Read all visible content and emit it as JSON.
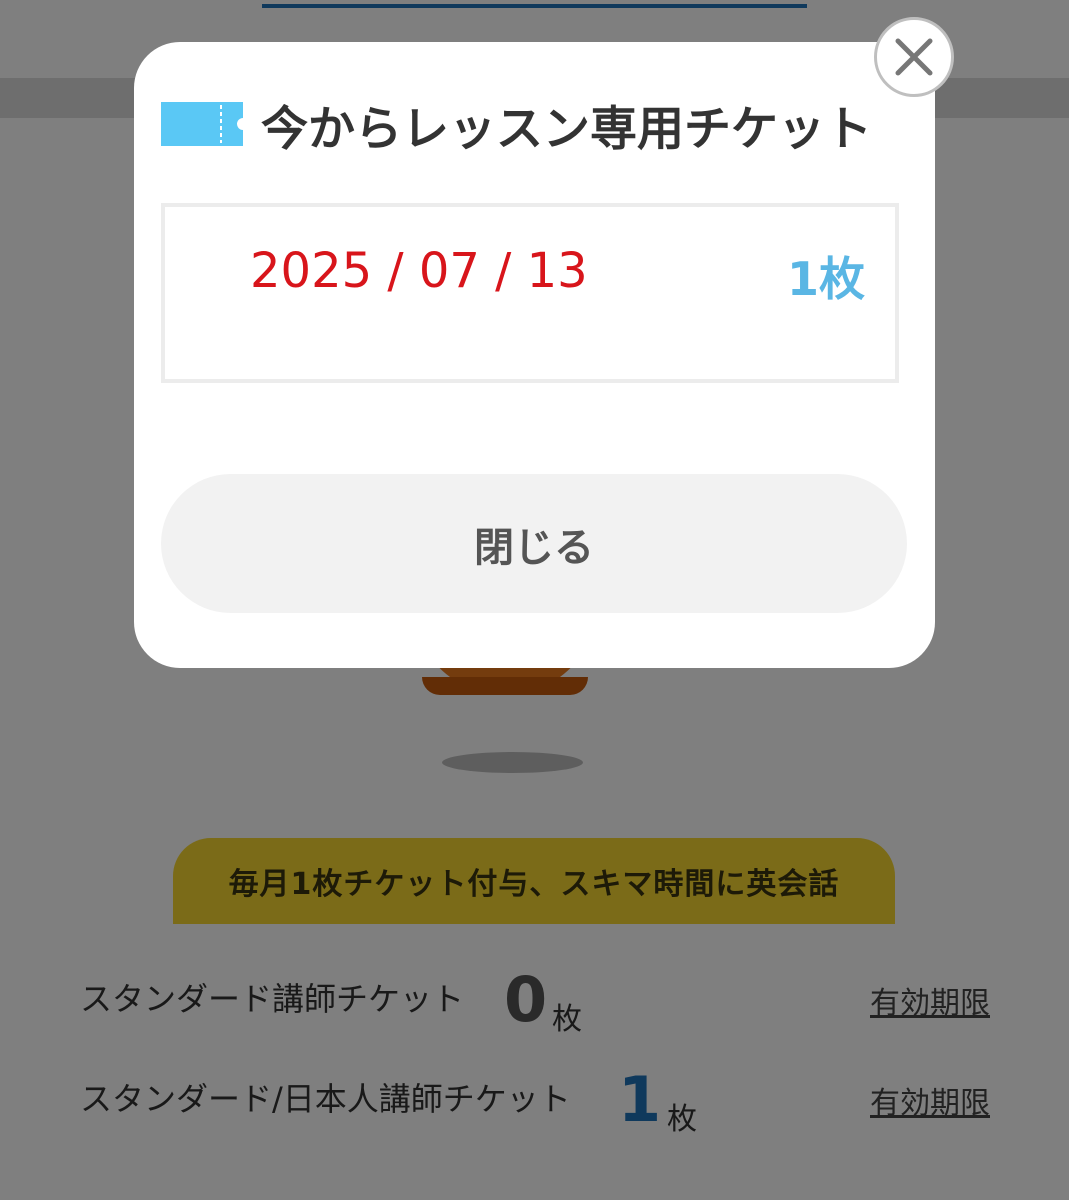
{
  "background": {
    "promo_banner": "毎月1枚チケット付与、スキマ時間に英会話",
    "tickets": [
      {
        "label": "スタンダード講師チケット",
        "count": "0",
        "unit": "枚",
        "expiry_link": "有効期限"
      },
      {
        "label": "スタンダード/日本人講師チケット",
        "count": "1",
        "unit": "枚",
        "expiry_link": "有効期限"
      }
    ]
  },
  "modal": {
    "title": "今からレッスン専用チケット",
    "ticket_entry": {
      "date": "2025 / 07 / 13",
      "quantity": "1枚"
    },
    "close_button_label": "閉じる"
  },
  "icons": {
    "ticket": "ticket-icon",
    "close": "close-icon"
  },
  "colors": {
    "overlay": "rgba(0,0,0,0.5)",
    "ticket_icon": "#5ac8f5",
    "date_text": "#d8151b",
    "quantity_text": "#5ab6e4",
    "count_highlight": "#1f72b8",
    "promo_banner_bg": "#f6d730"
  }
}
